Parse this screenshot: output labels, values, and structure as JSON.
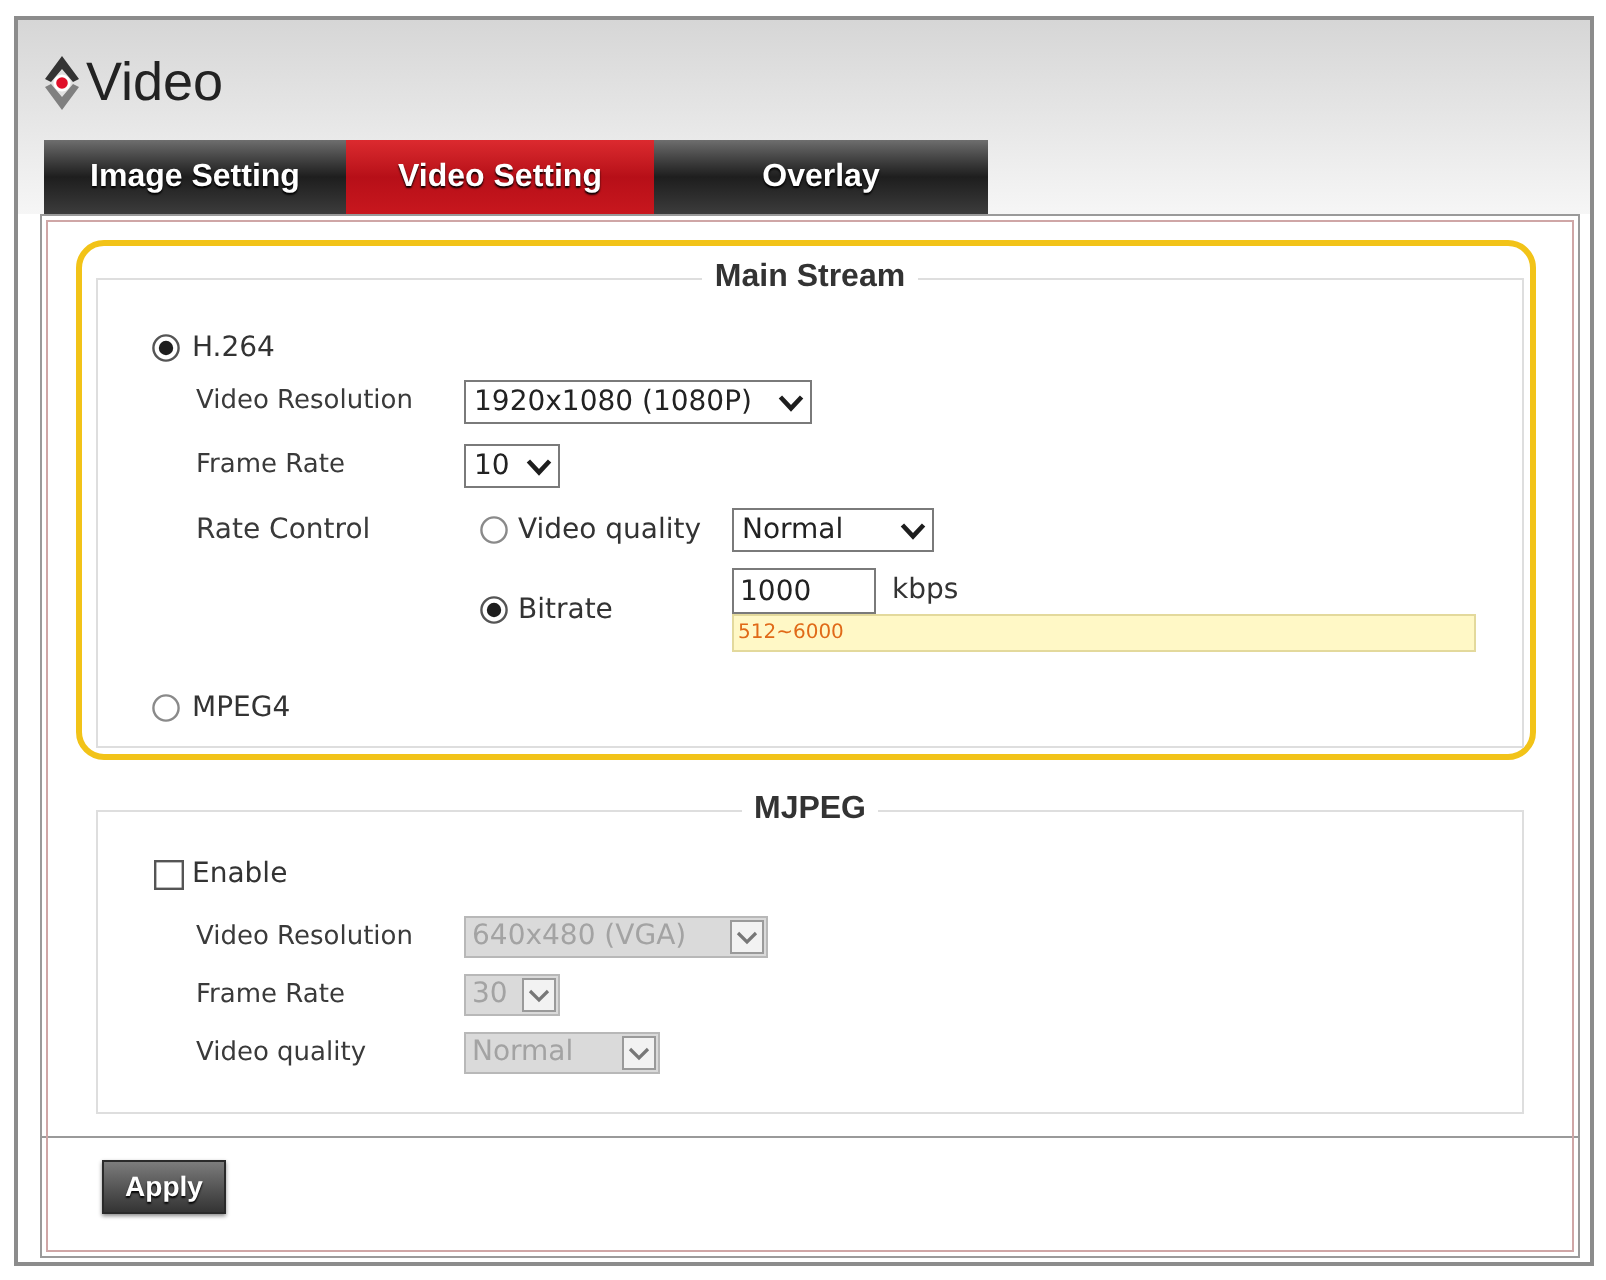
{
  "page": {
    "title": "Video"
  },
  "tabs": [
    {
      "label": "Image Setting",
      "selected": false
    },
    {
      "label": "Video Setting",
      "selected": true
    },
    {
      "label": "Overlay",
      "selected": false
    }
  ],
  "main_stream": {
    "title": "Main Stream",
    "highlighted": true,
    "codecs": [
      {
        "label": "H.264",
        "selected": true,
        "settings": [
          {
            "label": "Video Resolution",
            "value": "1920x1080 (1080P)",
            "disabled": false
          },
          {
            "label": "Frame Rate",
            "value": "10",
            "disabled": false
          }
        ],
        "rate_control": {
          "label": "Rate Control",
          "options": [
            {
              "kind": "select",
              "label": "Video quality",
              "selected": false,
              "value": "Normal"
            },
            {
              "kind": "input",
              "label": "Bitrate",
              "selected": true,
              "value": "1000",
              "unit": "kbps",
              "hint": "512~6000"
            }
          ]
        }
      },
      {
        "label": "MPEG4",
        "selected": false
      }
    ]
  },
  "mjpeg": {
    "title": "MJPEG",
    "enable": {
      "label": "Enable",
      "checked": false
    },
    "settings": [
      {
        "label": "Video Resolution",
        "value": "640x480 (VGA)",
        "disabled": true
      },
      {
        "label": "Frame Rate",
        "value": "30",
        "disabled": true
      },
      {
        "label": "Video quality",
        "value": "Normal",
        "disabled": true
      }
    ]
  },
  "apply_button": {
    "label": "Apply"
  }
}
